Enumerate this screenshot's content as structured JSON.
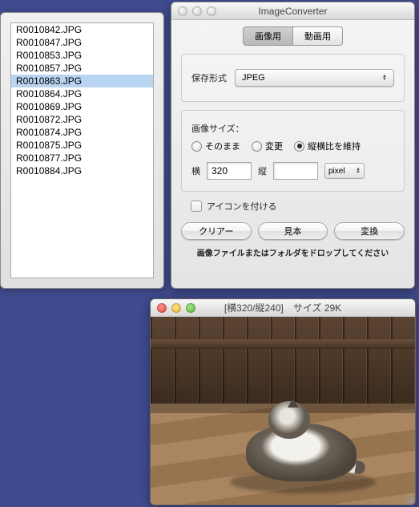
{
  "file_panel": {
    "items": [
      "R0010842.JPG",
      "R0010847.JPG",
      "R0010853.JPG",
      "R0010857.JPG",
      "R0010863.JPG",
      "R0010864.JPG",
      "R0010869.JPG",
      "R0010872.JPG",
      "R0010874.JPG",
      "R0010875.JPG",
      "R0010877.JPG",
      "R0010884.JPG"
    ],
    "selected_index": 4
  },
  "main": {
    "title": "ImageConverter",
    "tabs": {
      "image": "画像用",
      "movie": "動画用",
      "active": 0
    },
    "format_label": "保存形式",
    "format_value": "JPEG",
    "size_section_label": "画像サイズ：",
    "radios": {
      "asis": "そのまま",
      "change": "変更",
      "keep_ratio": "縦横比を維持",
      "selected": "keep_ratio"
    },
    "width_label": "横",
    "width_value": "320",
    "height_label": "縦",
    "height_value": "",
    "unit": "pixel",
    "icon_checkbox_label": "アイコンを付ける",
    "buttons": {
      "clear": "クリアー",
      "sample": "見本",
      "convert": "変換"
    },
    "footer": "画像ファイルまたはフォルダをドロップしてください"
  },
  "preview": {
    "title": "[横320/縦240]　サイズ 29K"
  }
}
